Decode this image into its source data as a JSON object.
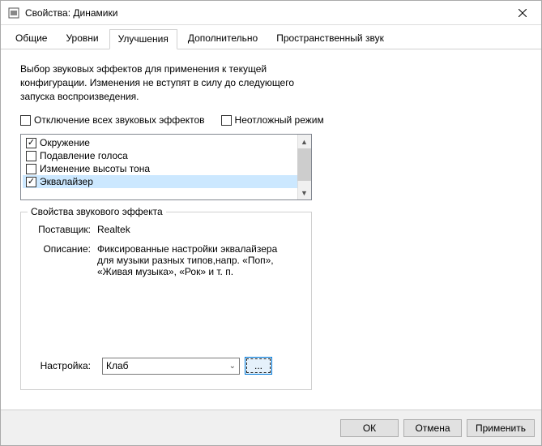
{
  "window": {
    "title": "Свойства: Динамики"
  },
  "tabs": [
    {
      "label": "Общие",
      "active": false
    },
    {
      "label": "Уровни",
      "active": false
    },
    {
      "label": "Улучшения",
      "active": true
    },
    {
      "label": "Дополнительно",
      "active": false
    },
    {
      "label": "Пространственный звук",
      "active": false
    }
  ],
  "description": "Выбор звуковых эффектов для применения к текущей конфигурации. Изменения не вступят в силу до следующего запуска воспроизведения.",
  "top_checks": {
    "disable_all": {
      "label": "Отключение всех звуковых эффектов",
      "checked": false
    },
    "immediate": {
      "label": "Неотложный режим",
      "checked": false
    }
  },
  "effects_list": [
    {
      "label": "Окружение",
      "checked": true,
      "selected": false
    },
    {
      "label": "Подавление голоса",
      "checked": false,
      "selected": false
    },
    {
      "label": "Изменение высоты тона",
      "checked": false,
      "selected": false
    },
    {
      "label": "Эквалайзер",
      "checked": true,
      "selected": true
    }
  ],
  "group": {
    "legend": "Свойства звукового эффекта",
    "vendor_label": "Поставщик:",
    "vendor_value": "Realtek",
    "desc_label": "Описание:",
    "desc_value": "Фиксированные настройки эквалайзера для музыки разных типов,напр. «Поп», «Живая музыка», «Рок» и т. п.",
    "setting_label": "Настройка:",
    "setting_value": "Клаб",
    "more_label": "..."
  },
  "buttons": {
    "ok": "ОК",
    "cancel": "Отмена",
    "apply": "Применить"
  }
}
